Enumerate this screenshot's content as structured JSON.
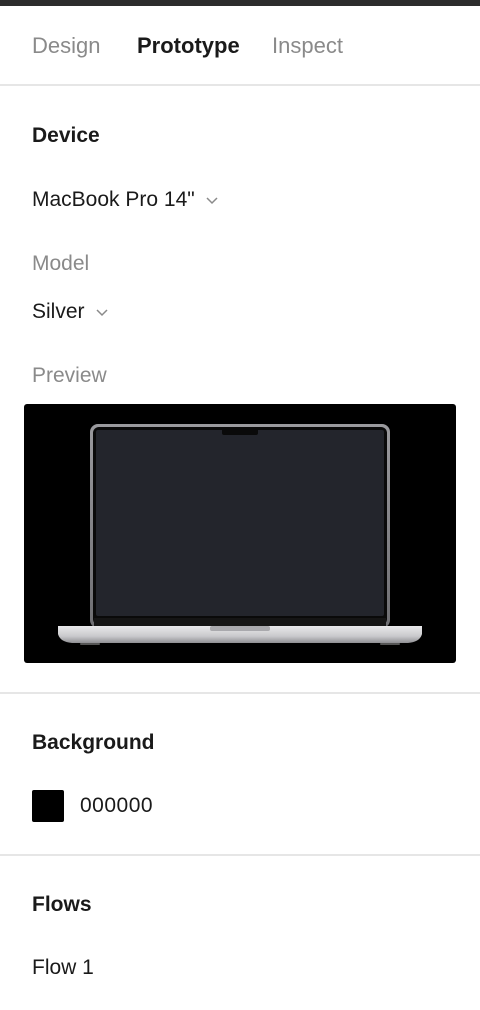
{
  "tabs": [
    {
      "label": "Design"
    },
    {
      "label": "Prototype"
    },
    {
      "label": "Inspect"
    }
  ],
  "active_tab": "Prototype",
  "device": {
    "title": "Device",
    "selected": "MacBook Pro 14\"",
    "model_label": "Model",
    "model_selected": "Silver",
    "preview_label": "Preview"
  },
  "background": {
    "title": "Background",
    "hex": "000000",
    "color": "#000000"
  },
  "flows": {
    "title": "Flows",
    "items": [
      {
        "label": "Flow 1"
      }
    ]
  },
  "colors": {
    "text_primary": "#1a1a1a",
    "text_secondary": "#8a8a8a",
    "divider": "#e6e6e6",
    "topbar": "#2c2c2c"
  },
  "icons": {
    "dropdown": "chevron-down-icon",
    "device": "laptop-mockup"
  }
}
